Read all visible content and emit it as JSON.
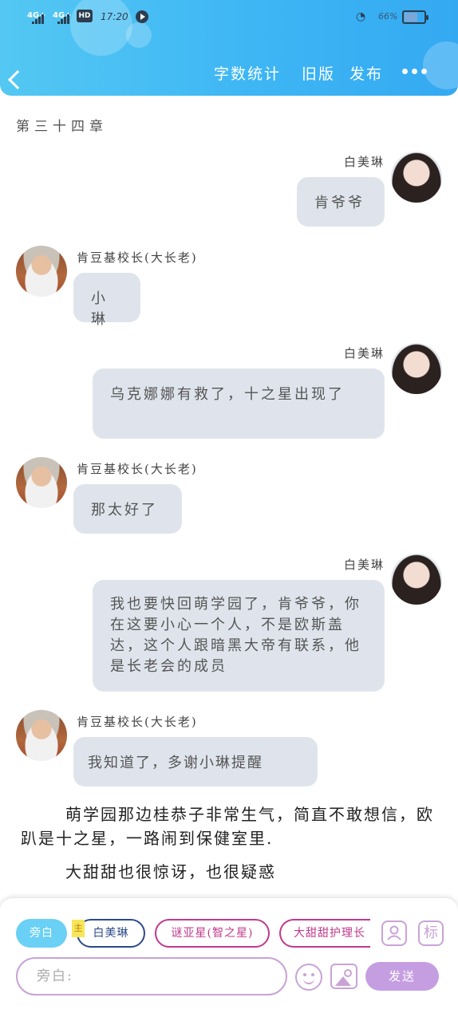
{
  "status_bar": {
    "net1": "4G+",
    "net2": "4G+",
    "hd": "HD",
    "time": "17:20",
    "battery": "66%",
    "battery_level": 0.66
  },
  "header": {
    "word_count_label": "字数统计",
    "old_version_label": "旧版",
    "publish_label": "发布"
  },
  "chapter_title": "第三十四章",
  "messages": [
    {
      "speaker": "白美琳",
      "side": "right",
      "text": "肯爷爷"
    },
    {
      "speaker": "肯豆基校长(大长老)",
      "side": "left",
      "text": "小琳"
    },
    {
      "speaker": "白美琳",
      "side": "right",
      "text": "乌克娜娜有救了，十之星出现了"
    },
    {
      "speaker": "肯豆基校长(大长老)",
      "side": "left",
      "text": "那太好了"
    },
    {
      "speaker": "白美琳",
      "side": "right",
      "text": "我也要快回萌学园了，肯爷爷，你在这要小心一个人，不是欧斯盖达，这个人跟暗黑大帝有联系，他是长老会的成员"
    },
    {
      "speaker": "肯豆基校长(大长老)",
      "side": "left",
      "text": "我知道了，多谢小琳提醒"
    }
  ],
  "narration": [
    "萌学园那边桂恭子非常生气，简直不敢想信，欧趴是十之星，一路闹到保健室里.",
    "大甜甜也很惊讶，也很疑惑"
  ],
  "composer": {
    "roles": [
      "旁白",
      "白美琳",
      "谜亚星(智之星)",
      "大甜甜护理长"
    ],
    "main_tag": "主",
    "input_placeholder": "旁白:",
    "profile_icon_label": "",
    "mark_label": "标",
    "send_label": "发送"
  },
  "colors": {
    "header_gradient_start": "#54c8f3",
    "header_gradient_end": "#34a9f2",
    "bubble_bg": "#dfe4ec",
    "accent_purple": "#c59ee2",
    "chip_blue": "#6ad0f5",
    "chip_magenta": "#c0398c"
  }
}
